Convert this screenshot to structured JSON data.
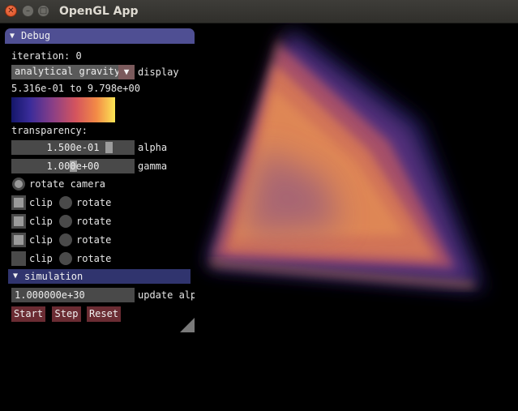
{
  "window": {
    "title": "OpenGL App"
  },
  "debug": {
    "header": "Debug",
    "iteration": "iteration: 0",
    "combo_value": "analytical gravity",
    "combo_label": "display",
    "range": "5.316e-01 to 9.798e+00",
    "transparency": "transparency:",
    "alpha_value": "1.500e-01",
    "alpha_label": "alpha",
    "gamma_value": "1.000e+00",
    "gamma_label": "gamma",
    "rotate_camera": "rotate camera",
    "clips": [
      {
        "clip": "clip",
        "rotate": "rotate",
        "checked": true
      },
      {
        "clip": "clip",
        "rotate": "rotate",
        "checked": true
      },
      {
        "clip": "clip",
        "rotate": "rotate",
        "checked": true
      },
      {
        "clip": "clip",
        "rotate": "rotate",
        "checked": false
      }
    ]
  },
  "simulation": {
    "header": "simulation",
    "input_value": "1.000000e+30",
    "input_label": "update alp",
    "start": "Start",
    "step": "Step",
    "reset": "Reset"
  },
  "colors": {
    "header": "#4f4f93",
    "button": "#6b2c33",
    "colormap": [
      "#14176a",
      "#8a3f86",
      "#d4545e",
      "#f38a46",
      "#fbe655"
    ]
  }
}
